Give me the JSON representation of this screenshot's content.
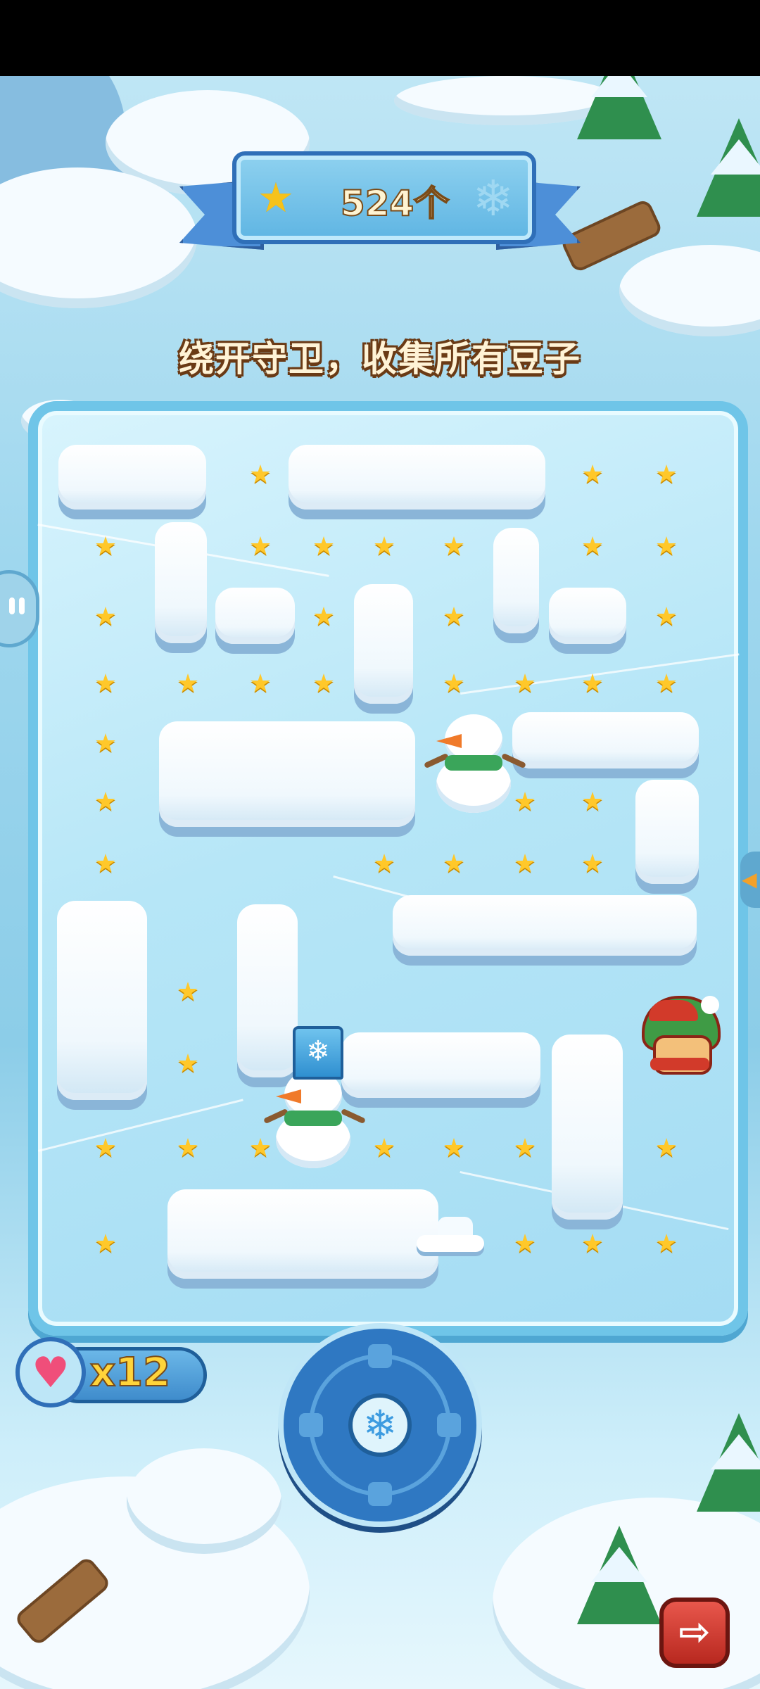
{
  "game": {
    "bean_total": "524个",
    "instruction": "绕开守卫，收集所有豆子",
    "lives": "x12"
  },
  "icons": {
    "banner_star": "star-icon",
    "banner_flake": "snowflake-icon",
    "heart": "heart-icon",
    "joystick": "snowflake-icon",
    "exit": "exit-icon",
    "pause": "pause-icon"
  },
  "colors": {
    "bean": "#ffc82a",
    "heart": "#f04e7a",
    "exit_button": "#d23a2a",
    "joystick": "#2f78c2"
  }
}
